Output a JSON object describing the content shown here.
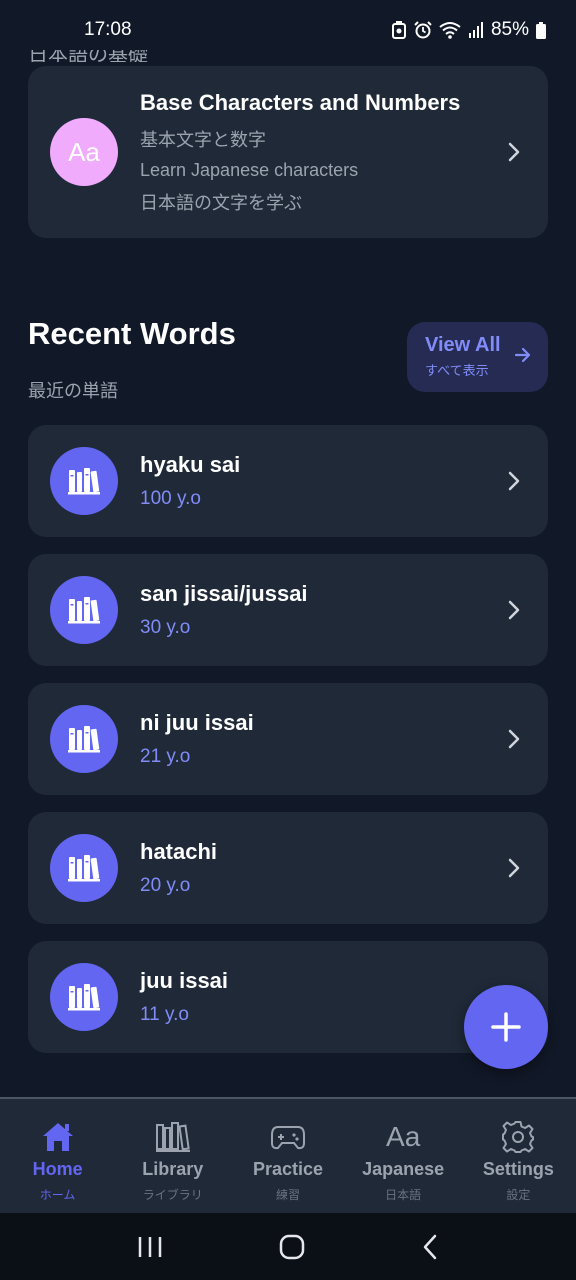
{
  "status_bar": {
    "time": "17:08",
    "battery": "85%"
  },
  "top": {
    "cut_heading": "日本語の基礎"
  },
  "base_card": {
    "title": "Base Characters and Numbers",
    "line1": "基本文字と数字",
    "line2": "Learn Japanese characters",
    "line3": "日本語の文字を学ぶ",
    "avatar_text": "Aa",
    "avatar_color": "#f0abfc"
  },
  "recent": {
    "title": "Recent Words",
    "subtitle": "最近の単語",
    "view_all": {
      "label": "View All",
      "sub": "すべて表示"
    }
  },
  "words": [
    {
      "word": "hyaku sai",
      "meaning": "100 y.o"
    },
    {
      "word": "san jissai/jussai",
      "meaning": "30 y.o"
    },
    {
      "word": "ni juu issai",
      "meaning": "21 y.o"
    },
    {
      "word": "hatachi",
      "meaning": "20 y.o"
    },
    {
      "word": "juu issai",
      "meaning": "11 y.o"
    }
  ],
  "nav": [
    {
      "label": "Home",
      "sub": "ホーム",
      "icon": "home-icon",
      "active": true
    },
    {
      "label": "Library",
      "sub": "ライブラリ",
      "icon": "library-icon",
      "active": false
    },
    {
      "label": "Practice",
      "sub": "練習",
      "icon": "gamepad-icon",
      "active": false
    },
    {
      "label": "Japanese",
      "sub": "日本語",
      "icon": "aa-icon",
      "glyph": "Aa",
      "active": false
    },
    {
      "label": "Settings",
      "sub": "設定",
      "icon": "gear-icon",
      "active": false
    }
  ],
  "colors": {
    "accent": "#6366f1",
    "accent_light": "#818cf8",
    "background": "#111827",
    "card": "#1f2937"
  }
}
